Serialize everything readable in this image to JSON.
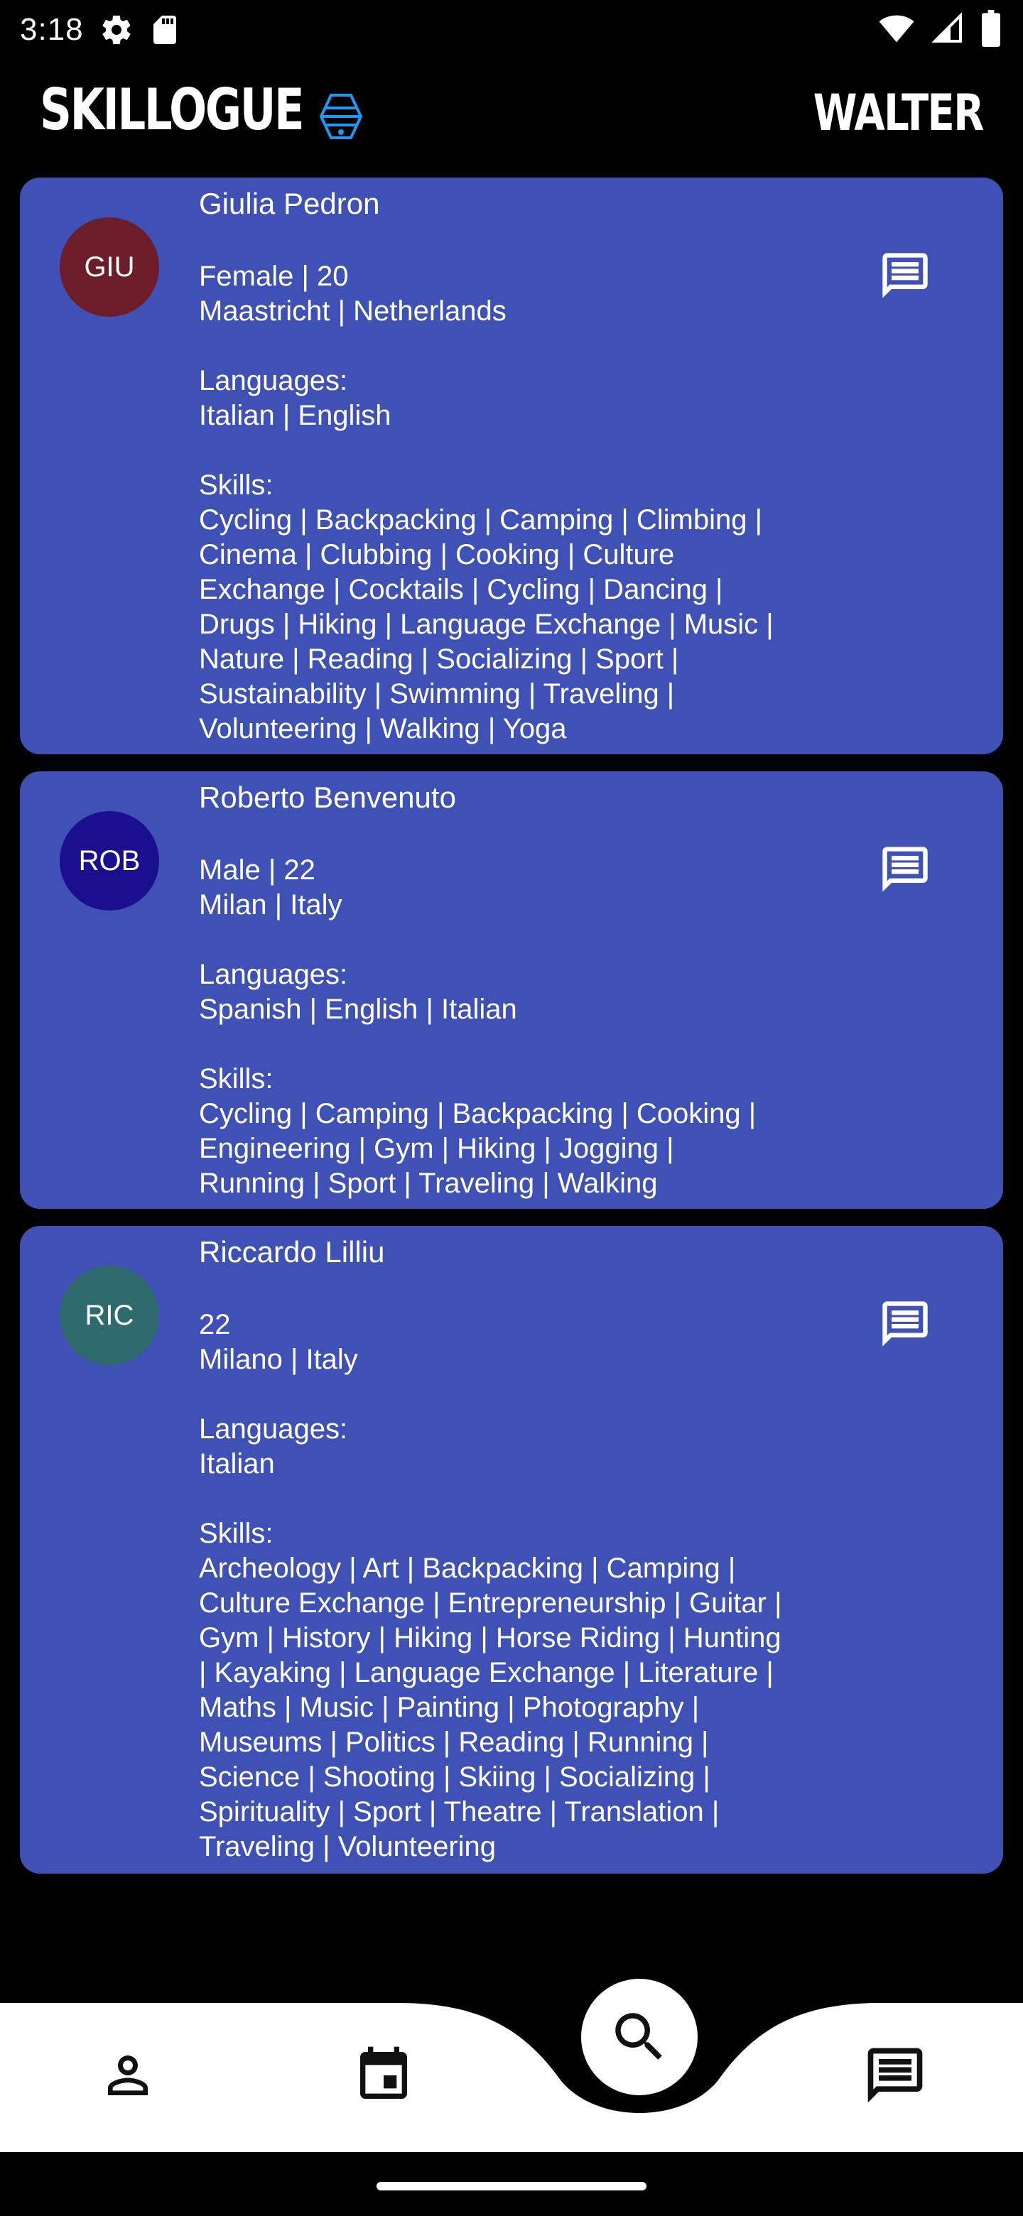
{
  "status_bar": {
    "time": "3:18",
    "icons": [
      "settings-icon",
      "sd-card-icon",
      "wifi-icon",
      "signal-icon",
      "battery-icon"
    ]
  },
  "app_bar": {
    "title": "SKILLOGUE",
    "user": "WALTER",
    "logo_icon": "hive-logo-icon"
  },
  "colors": {
    "card_background": "#3f51b5",
    "screen_background": "#000000",
    "nav_background": "#ffffff"
  },
  "profiles": [
    {
      "initials": "GIU",
      "avatar_color": "#6d1c2a",
      "name": "Giulia Pedron",
      "demographics": "Female | 20",
      "location": "Maastricht | Netherlands",
      "languages_label": "Languages:",
      "languages": "Italian | English",
      "skills_label": "Skills:",
      "skills_lines": [
        "Cycling | Backpacking | Camping | Climbing |",
        "Cinema | Clubbing | Cooking | Culture",
        "Exchange | Cocktails | Cycling  | Dancing |",
        "Drugs | Hiking | Language Exchange | Music |",
        "Nature | Reading | Socializing | Sport |",
        "Sustainability | Swimming | Traveling |",
        "Volunteering | Walking | Yoga"
      ]
    },
    {
      "initials": "ROB",
      "avatar_color": "#1a0f8f",
      "name": "Roberto Benvenuto",
      "demographics": "Male | 22",
      "location": "Milan | Italy",
      "languages_label": "Languages:",
      "languages": "Spanish | English | Italian",
      "skills_label": "Skills:",
      "skills_lines": [
        "Cycling | Camping | Backpacking | Cooking |",
        "Engineering  | Gym | Hiking | Jogging |",
        "Running | Sport | Traveling | Walking"
      ]
    },
    {
      "initials": "RIC",
      "avatar_color": "#2f6b6e",
      "name": "Riccardo Lilliu",
      "demographics": "22",
      "location": "Milano | Italy",
      "languages_label": "Languages:",
      "languages": "Italian",
      "skills_label": "Skills:",
      "skills_lines": [
        "Archeology | Art | Backpacking | Camping |",
        "Culture Exchange | Entrepreneurship  | Guitar |",
        "Gym | History | Hiking | Horse Riding | Hunting",
        "| Kayaking | Language Exchange | Literature |",
        "Maths | Music | Painting | Photography |",
        "Museums | Politics | Reading | Running |",
        "Science | Shooting | Skiing | Socializing |",
        "Spirituality | Sport | Theatre | Translation |",
        "Traveling | Volunteering"
      ]
    }
  ],
  "bottom_nav": {
    "items": [
      "profile-icon",
      "calendar-icon",
      "search-icon",
      "chat-icon"
    ],
    "active": "search-icon"
  }
}
